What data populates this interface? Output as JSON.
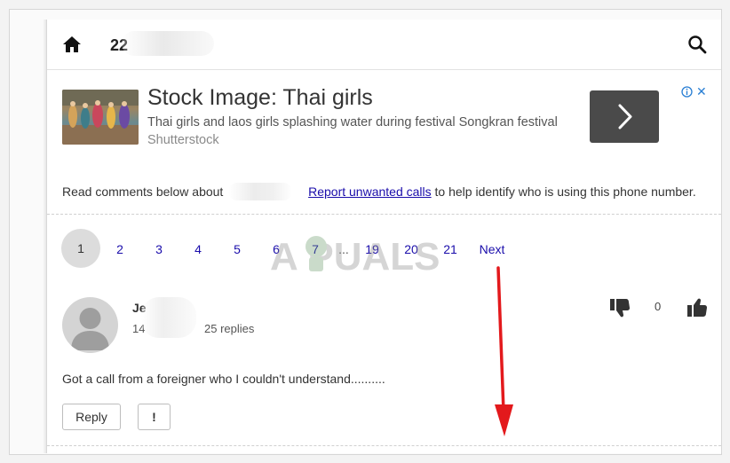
{
  "header": {
    "title_prefix": "22",
    "home_icon": "home-icon",
    "search_icon": "search-icon"
  },
  "ad": {
    "title": "Stock Image: Thai girls",
    "description": "Thai girls and laos girls splashing water during festival Songkran festival",
    "source": "Shutterstock",
    "info_icon": "info-icon",
    "close_icon": "close-icon",
    "close_glyph": "✕"
  },
  "notice": {
    "lead": "Read comments below about",
    "link": "Report unwanted calls",
    "tail": "to help identify who is using this phone number."
  },
  "pagination": {
    "current": "1",
    "pages": [
      "2",
      "3",
      "4",
      "5",
      "6",
      "7"
    ],
    "ellipsis": "...",
    "later_pages": [
      "19",
      "20",
      "21"
    ],
    "next": "Next"
  },
  "watermark": {
    "text": "A PUALS"
  },
  "comment": {
    "author_prefix": "Je",
    "date_prefix": "14",
    "replies": "25 replies",
    "vote_count": "0",
    "text": "Got a call from a foreigner who I couldn't understand..........",
    "reply_label": "Reply",
    "flag_label": "!"
  },
  "colors": {
    "link": "#1a0dab",
    "ad_button": "#4a4a4a",
    "annotation_arrow": "#e3191c"
  }
}
